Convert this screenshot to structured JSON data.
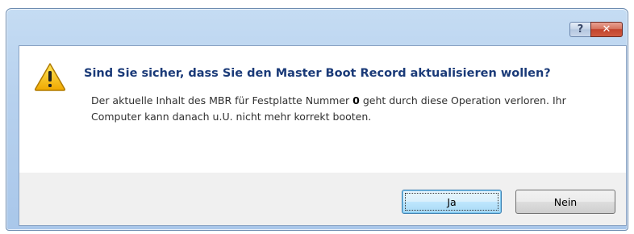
{
  "titlebar": {
    "help_label": "?",
    "close_label": "✕"
  },
  "dialog": {
    "heading": "Sind Sie sicher, dass Sie den Master Boot Record aktualisieren wollen?",
    "desc_part1": "Der aktuelle Inhalt des MBR für Festplatte Nummer ",
    "disk_number": "0",
    "desc_part2": " geht durch diese Operation verloren. Ihr Computer kann danach u.U. nicht mehr korrekt booten.",
    "icon": "warning-icon"
  },
  "buttons": {
    "yes_label": "Ja",
    "no_label": "Nein"
  },
  "colors": {
    "heading": "#1a3a78",
    "warning_fill": "#f5c400",
    "close_button": "#c2432d"
  }
}
